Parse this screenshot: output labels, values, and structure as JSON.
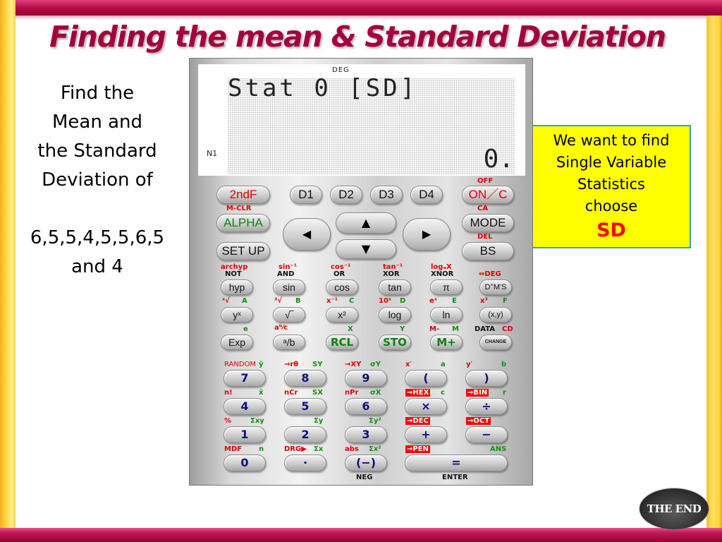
{
  "slide": {
    "title": "Finding  the mean & Standard Deviation",
    "left_text": {
      "lines": [
        "Find the",
        "Mean and",
        "the Standard",
        "Deviation of"
      ],
      "data_lines": [
        "6,5,5,4,5,5,6,5",
        "and 4"
      ]
    },
    "callout": {
      "lines": [
        "We want to find",
        "Single Variable",
        "Statistics",
        "choose"
      ],
      "highlight": "SD",
      "bg_color": "#ffff00",
      "border_color": "#2aa0d8",
      "highlight_color": "#ff0000"
    },
    "end_button": "THE END",
    "colors": {
      "title": "#a3003e",
      "frame_top": "#b8104a",
      "frame_side": "#ffd540"
    }
  },
  "calculator": {
    "screen": {
      "indicator": "DEG",
      "line1": "Stat 0 [SD]",
      "status": "N1",
      "value": "0."
    },
    "row1": {
      "second_f": "2ndF",
      "d1": "D1",
      "d2": "D2",
      "d3": "D3",
      "d4": "D4",
      "on_c": "ON／C",
      "off_label": "OFF",
      "ca_label": "CA"
    },
    "row2": {
      "m_clr_label": "M-CLR",
      "alpha": "ALPHA",
      "mode": "MODE",
      "del_label": "DEL",
      "left": "◀",
      "up": "▲",
      "down": "▼",
      "right": "▶"
    },
    "row3": {
      "setup": "SET UP",
      "bs": "BS"
    },
    "sci_row1": {
      "keys": [
        "hyp",
        "sin",
        "cos",
        "tan",
        "π",
        "D°M′S"
      ],
      "labels_top_red": [
        "archyp",
        "sin⁻¹",
        "cos⁻¹",
        "tan⁻¹",
        "logₐX",
        "⇔DEG"
      ],
      "labels_top_black": [
        "NOT",
        "AND",
        "OR",
        "XOR",
        "XNOR"
      ]
    },
    "sci_row2": {
      "keys": [
        "yˣ",
        "√‾",
        "x²",
        "log",
        "ln",
        "(x,y)"
      ],
      "labels_red": [
        "ˣ√",
        "³√",
        "x⁻¹",
        "10ˣ",
        "eˣ",
        "x³"
      ],
      "labels_green": [
        "A",
        "B",
        "C",
        "D",
        "E",
        "F"
      ]
    },
    "sci_row3": {
      "keys": [
        "Exp",
        "ᵃ/b",
        "RCL",
        "STO",
        "M+",
        "CHANGE"
      ],
      "labels_green": [
        "e",
        "X",
        "Y",
        "M"
      ],
      "label_red_ab": "aᵇ⁄c",
      "label_red_m": "M-",
      "label_data": "DATA",
      "label_cd": "CD"
    },
    "num_row1": {
      "keys": [
        "7",
        "8",
        "9",
        "(",
        ")"
      ],
      "labels": [
        "RANDOM",
        "ȳ",
        "→rθ",
        "SY",
        "→XY",
        "σY",
        "x′",
        "a",
        "y′",
        "b"
      ]
    },
    "num_row2": {
      "keys": [
        "4",
        "5",
        "6",
        "×",
        "÷"
      ],
      "labels": [
        "n!",
        "x̄",
        "nCr",
        "SX",
        "nPr",
        "σX",
        "→HEX",
        "c",
        "→BIN",
        "r"
      ]
    },
    "num_row3": {
      "keys": [
        "1",
        "2",
        "3",
        "+",
        "−"
      ],
      "labels": [
        "%",
        "Σxy",
        "Σy",
        "Σy²",
        "→DEC",
        "→OCT"
      ]
    },
    "num_row4": {
      "keys": [
        "0",
        "·",
        "(−)",
        "="
      ],
      "labels": [
        "MDF",
        "n",
        "DRG▶",
        "Σx",
        "abs",
        "Σx²",
        "→PEN",
        "ANS"
      ],
      "below": [
        "NEG",
        "ENTER"
      ]
    }
  }
}
